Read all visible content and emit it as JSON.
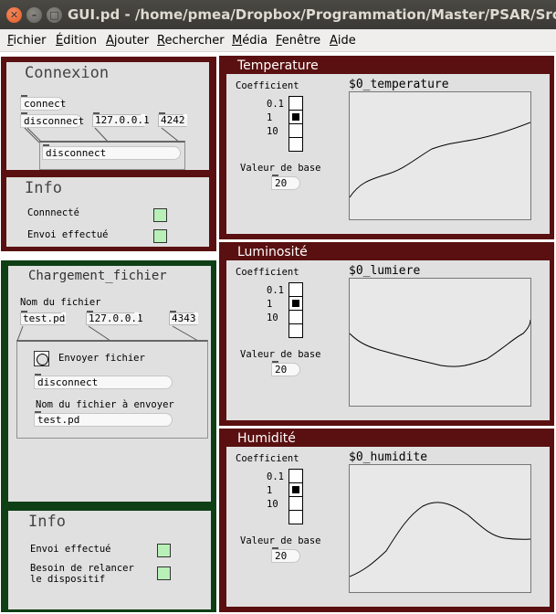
{
  "window": {
    "title": "GUI.pd  - /home/pmea/Dropbox/Programmation/Master/PSAR/Src"
  },
  "menu": [
    "Fichier",
    "Édition",
    "Ajouter",
    "Rechercher",
    "Média",
    "Fenêtre",
    "Aide"
  ],
  "colors": {
    "red_panel": "#5a1010",
    "green_panel": "#0f3f15",
    "toggle_fill": "#b8f0b8"
  },
  "connexion": {
    "title": "Connexion",
    "connect_msg": "connect",
    "disconnect_msg": "disconnect",
    "ip": "127.0.0.1",
    "port": "4242",
    "object": "disconnect"
  },
  "info1": {
    "title": "Info",
    "connected_label": "Connnecté",
    "sent_label": "Envoi effectué"
  },
  "chargement": {
    "title": "Chargement_fichier",
    "filename_label": "Nom du fichier",
    "filename": "test.pd",
    "ip": "127.0.0.1",
    "port": "4343",
    "send_label": "Envoyer fichier",
    "disconnect_object": "disconnect",
    "send_filename_label": "Nom du fichier à envoyer",
    "send_filename": "test.pd"
  },
  "info2": {
    "title": "Info",
    "sent_label": "Envoi effectué",
    "restart_label_1": "Besoin de relancer",
    "restart_label_2": "le dispositif"
  },
  "sensors": [
    {
      "title": "Temperature",
      "coef_label": "Coefficient",
      "radio": [
        "0.1",
        "1",
        "10"
      ],
      "selected": 1,
      "base_label": "Valeur de base",
      "base_value": "20",
      "array": "$0_temperature"
    },
    {
      "title": "Luminosité",
      "coef_label": "Coefficient",
      "radio": [
        "0.1",
        "1",
        "10"
      ],
      "selected": 1,
      "base_label": "Valeur de base",
      "base_value": "20",
      "array": "$0_lumiere"
    },
    {
      "title": "Humidité",
      "coef_label": "Coefficient",
      "radio": [
        "0.1",
        "1",
        "10"
      ],
      "selected": 1,
      "base_label": "Valeur de base",
      "base_value": "20",
      "array": "$0_humidite"
    }
  ]
}
